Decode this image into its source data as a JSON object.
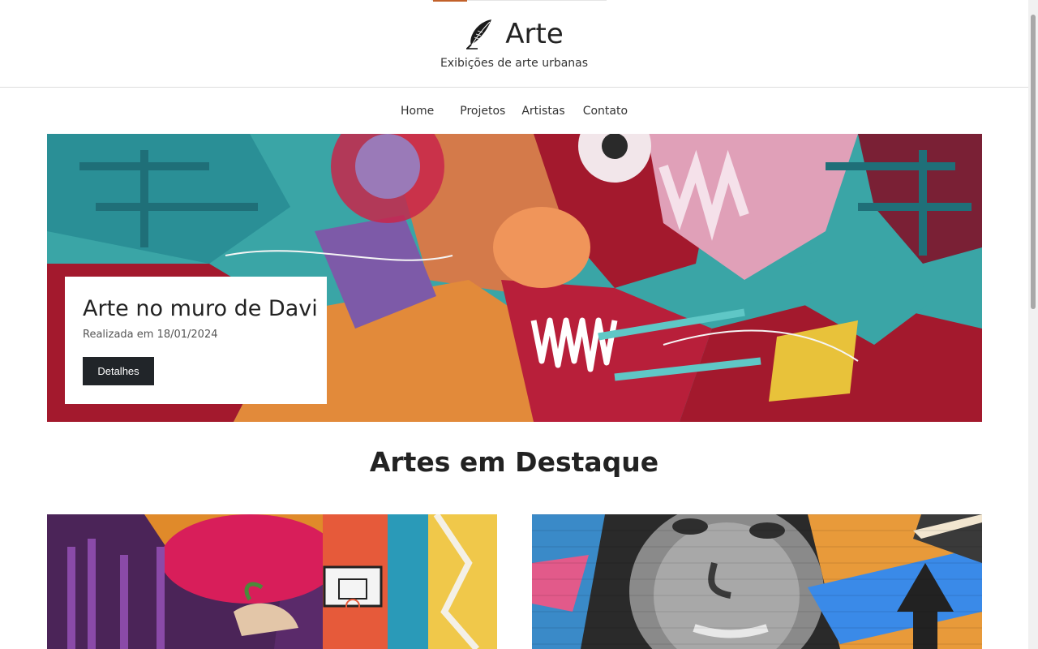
{
  "site": {
    "title": "Arte",
    "subtitle": "Exibições de arte urbanas",
    "logo_icon": "quill-feather-icon",
    "accent_color": "#c2612a"
  },
  "nav": {
    "items": [
      {
        "label": "Home"
      },
      {
        "label": "Projetos"
      },
      {
        "label": "Artistas"
      },
      {
        "label": "Contato"
      }
    ]
  },
  "hero": {
    "title": "Arte no muro de Davi",
    "subtitle": "Realizada em 18/01/2024",
    "button_label": "Detalhes"
  },
  "featured": {
    "section_title": "Artes em Destaque"
  },
  "colors": {
    "button_bg": "#212529",
    "mural_teal": "#3aa5a6",
    "mural_red": "#a3192d"
  }
}
